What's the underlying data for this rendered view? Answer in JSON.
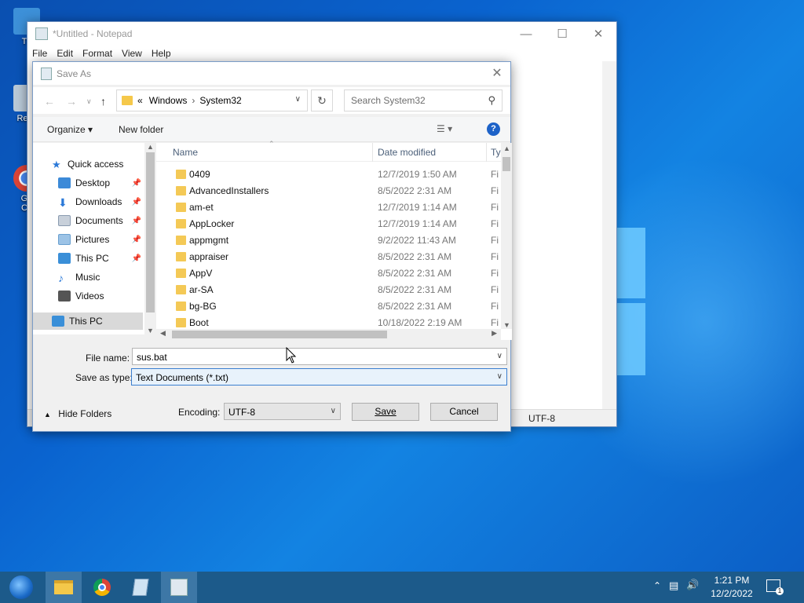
{
  "desktop": {
    "icons": [
      {
        "name": "This PC",
        "label": "Th"
      },
      {
        "name": "Recycle Bin",
        "label": "Recy"
      },
      {
        "name": "Google Chrome",
        "label_line1": "Go",
        "label_line2": "Ch"
      }
    ]
  },
  "notepad": {
    "title": "*Untitled - Notepad",
    "menu": [
      "File",
      "Edit",
      "Format",
      "View",
      "Help"
    ],
    "status_encoding": "UTF-8"
  },
  "dialog": {
    "title": "Save As",
    "address": {
      "prefix": "«",
      "parts": [
        "Windows",
        "System32"
      ]
    },
    "search_placeholder": "Search System32",
    "toolbar": {
      "organize": "Organize ▾",
      "new_folder": "New folder",
      "help": "?"
    },
    "nav": [
      {
        "label": "Quick access",
        "icon": "star-icon",
        "pinned": false,
        "color": "#2b79d8"
      },
      {
        "label": "Desktop",
        "icon": "desktop-icon",
        "pinned": true,
        "color": "#3c8ad8"
      },
      {
        "label": "Downloads",
        "icon": "download-icon",
        "pinned": true,
        "color": "#2b79d8"
      },
      {
        "label": "Documents",
        "icon": "documents-icon",
        "pinned": true,
        "color": "#8a9bb0"
      },
      {
        "label": "Pictures",
        "icon": "pictures-icon",
        "pinned": true,
        "color": "#6aa0d0"
      },
      {
        "label": "This PC",
        "icon": "pc-icon",
        "pinned": true,
        "color": "#3a8fd8"
      },
      {
        "label": "Music",
        "icon": "music-icon",
        "pinned": false,
        "color": "#2b79d8"
      },
      {
        "label": "Videos",
        "icon": "videos-icon",
        "pinned": false,
        "color": "#555"
      },
      {
        "label": "This PC",
        "icon": "pc-icon",
        "pinned": false,
        "color": "#3a8fd8",
        "selected": true
      }
    ],
    "columns": {
      "name": "Name",
      "date": "Date modified",
      "type": "Ty"
    },
    "files": [
      {
        "name": "0409",
        "date": "12/7/2019 1:50 AM",
        "type": "Fi"
      },
      {
        "name": "AdvancedInstallers",
        "date": "8/5/2022 2:31 AM",
        "type": "Fi"
      },
      {
        "name": "am-et",
        "date": "12/7/2019 1:14 AM",
        "type": "Fi"
      },
      {
        "name": "AppLocker",
        "date": "12/7/2019 1:14 AM",
        "type": "Fi"
      },
      {
        "name": "appmgmt",
        "date": "9/2/2022 11:43 AM",
        "type": "Fi"
      },
      {
        "name": "appraiser",
        "date": "8/5/2022 2:31 AM",
        "type": "Fi"
      },
      {
        "name": "AppV",
        "date": "8/5/2022 2:31 AM",
        "type": "Fi"
      },
      {
        "name": "ar-SA",
        "date": "8/5/2022 2:31 AM",
        "type": "Fi"
      },
      {
        "name": "bg-BG",
        "date": "8/5/2022 2:31 AM",
        "type": "Fi"
      },
      {
        "name": "Boot",
        "date": "10/18/2022 2:19 AM",
        "type": "Fi"
      }
    ],
    "file_name_label": "File name:",
    "file_name_value": "sus.bat",
    "save_type_label": "Save as type:",
    "save_type_value": "Text Documents (*.txt)",
    "hide_folders": "Hide Folders",
    "encoding_label": "Encoding:",
    "encoding_value": "UTF-8",
    "save_btn": "Save",
    "cancel_btn": "Cancel"
  },
  "taskbar": {
    "time": "1:21 PM",
    "date": "12/2/2022",
    "notification_count": "1"
  }
}
